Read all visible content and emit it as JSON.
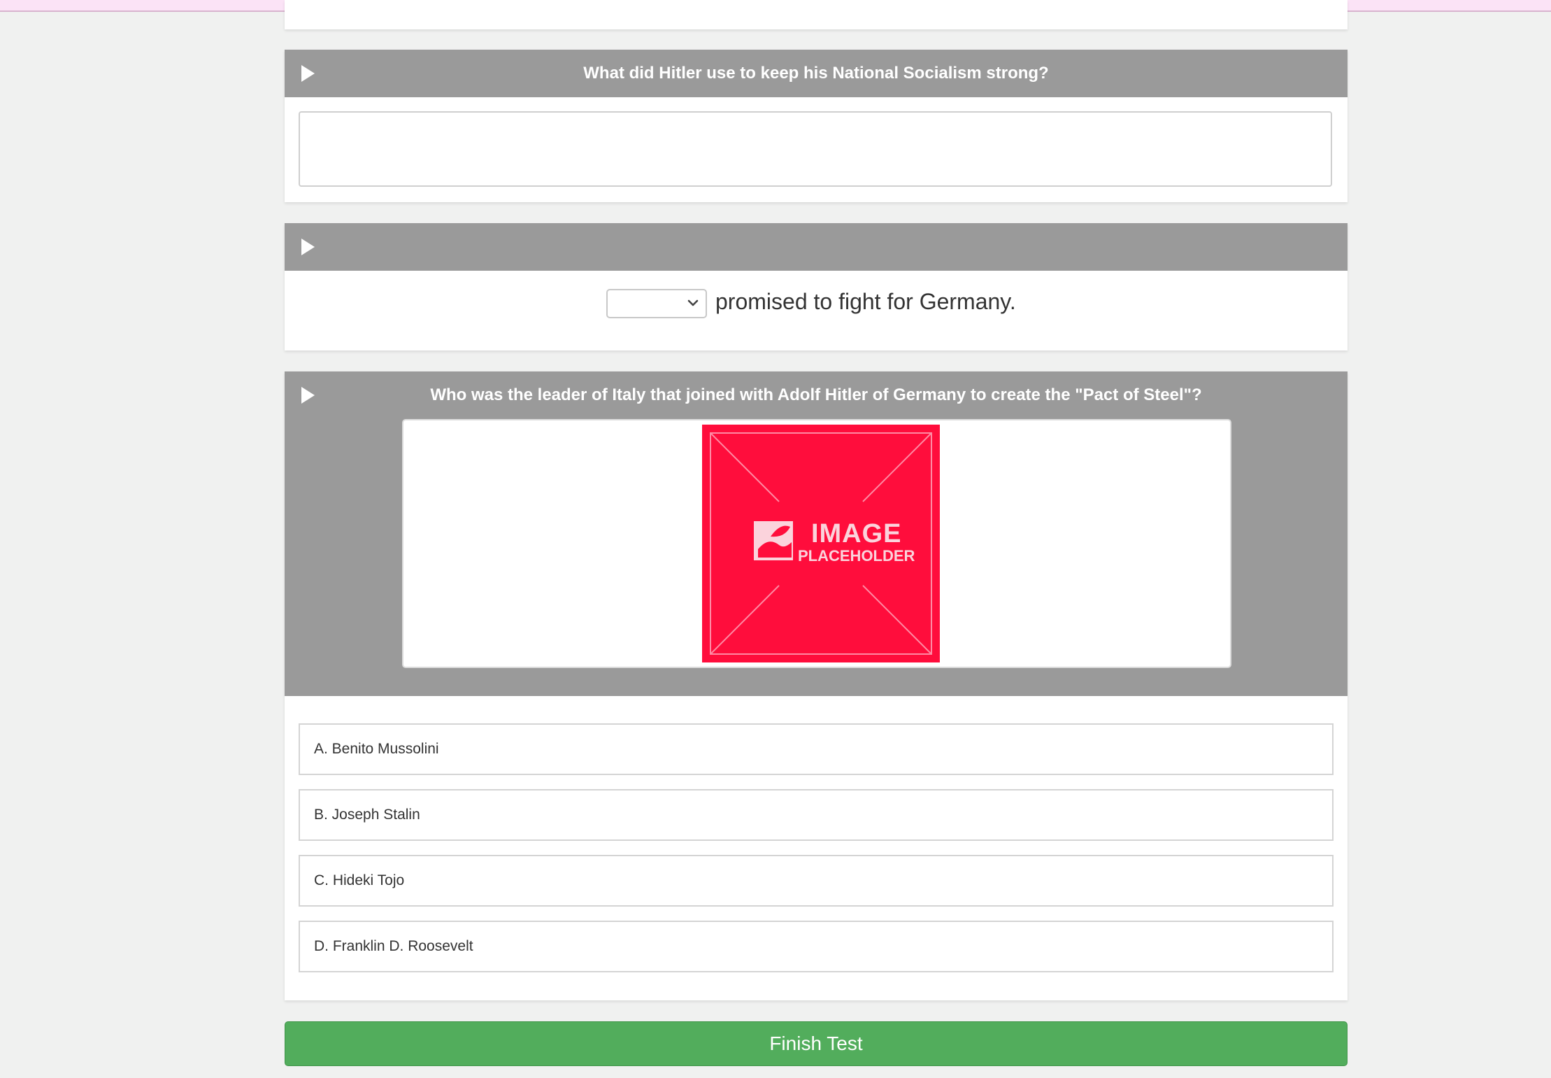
{
  "questions": [
    {
      "title": "What did Hitler use to keep his National Socialism strong?",
      "answer_value": ""
    },
    {
      "title": "",
      "select_value": "",
      "sentence_suffix": "promised to fight for Germany."
    },
    {
      "title": "Who was the leader of Italy that joined with Adolf Hitler of Germany to create the \"Pact of Steel\"?",
      "image": {
        "line1": "IMAGE",
        "line2": "PLACEHOLDER",
        "color": "#ff0d3c"
      },
      "options": [
        {
          "label": "A. Benito Mussolini"
        },
        {
          "label": "B. Joseph Stalin"
        },
        {
          "label": "C. Hideki Tojo"
        },
        {
          "label": "D. Franklin D. Roosevelt"
        }
      ]
    }
  ],
  "footer": {
    "finish_label": "Finish Test",
    "finish_color": "#52ad5c"
  },
  "colors": {
    "header_bg": "#9a9a9a",
    "page_bg": "#f0f1f0",
    "top_bar": "#fbe3f6"
  },
  "icons": {
    "play": "play-icon",
    "dropdown": "chevron-down-icon",
    "resize": "resize-grip-icon"
  }
}
